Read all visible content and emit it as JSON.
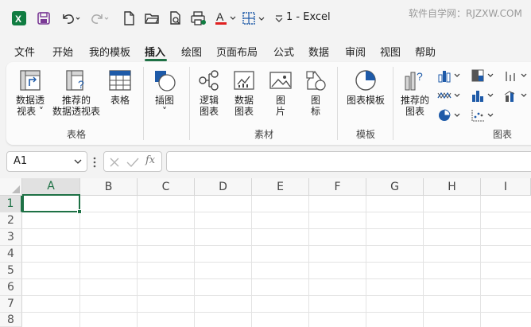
{
  "titlebar": {
    "doc_title": "1  -  Excel",
    "watermark": "软件自学网：RJZXW.COM"
  },
  "tabs": [
    {
      "label": "文件"
    },
    {
      "label": "开始"
    },
    {
      "label": "我的模板"
    },
    {
      "label": "插入",
      "active": true
    },
    {
      "label": "绘图"
    },
    {
      "label": "页面布局"
    },
    {
      "label": "公式"
    },
    {
      "label": "数据"
    },
    {
      "label": "审阅"
    },
    {
      "label": "视图"
    },
    {
      "label": "帮助"
    }
  ],
  "ribbon": {
    "pivot_table": "数据透\n视表 ˅",
    "recommended_pivot": "推荐的\n数据透视表",
    "table": "表格",
    "group_tables": "表格",
    "illustrations": "插图\n˅",
    "logic_chart": "逻辑\n图表",
    "data_chart": "数据\n图表",
    "picture": "图\n片",
    "icons": "图\n标",
    "group_assets": "素材",
    "chart_template": "图表模板",
    "group_templates": "模板",
    "recommended_chart": "推荐的\n图表",
    "group_charts": "图表"
  },
  "formula_bar": {
    "name_box": "A1",
    "fx": "fx"
  },
  "grid": {
    "columns": [
      "A",
      "B",
      "C",
      "D",
      "E",
      "F",
      "G",
      "H",
      "I"
    ],
    "rows": [
      "1",
      "2",
      "3",
      "4",
      "5",
      "6",
      "7",
      "8"
    ]
  },
  "colors": {
    "accent": "#1e7145",
    "excel_green": "#107c41"
  }
}
